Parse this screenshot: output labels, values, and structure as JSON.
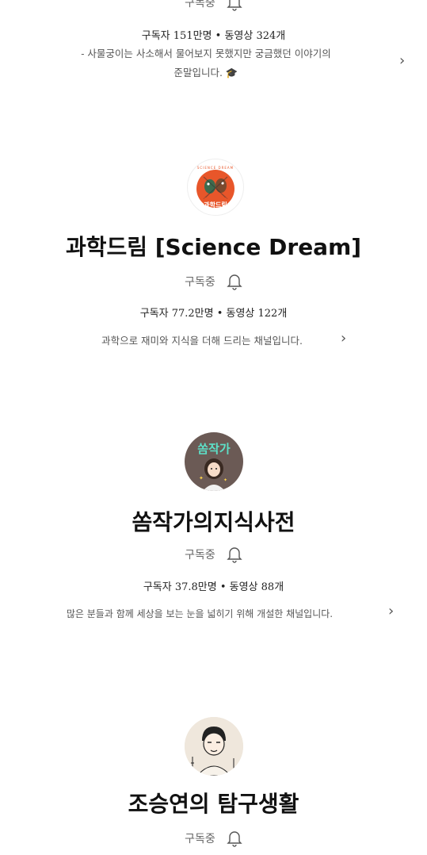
{
  "channels": [
    {
      "subscribed_label": "구독중",
      "stats": "구독자 151만명 • 동영상 324개",
      "description_line1": "- 사물궁이는 사소해서 물어보지 못했지만 궁금했던 이야기의",
      "description_line2": "준말입니다. 🎓"
    },
    {
      "title": "과학드림 [Science Dream]",
      "logo_text": "과학드림",
      "logo_arc_text": "SCIENCE DREAM",
      "subscribed_label": "구독중",
      "stats": "구독자 77.2만명 • 동영상 122개",
      "description": "과학으로 재미와 지식을 더해 드리는 채널입니다."
    },
    {
      "title": "쏨작가의지식사전",
      "logo_text": "쏨작가",
      "subscribed_label": "구독중",
      "stats": "구독자 37.8만명 • 동영상 88개",
      "description": "많은 분들과 함께 세상을 보는 눈을 넓히기 위해 개설한 채널입니다."
    },
    {
      "title": "조승연의 탐구생활",
      "subscribed_label": "구독중"
    }
  ],
  "icons": {
    "bell": "bell-icon",
    "chevron": "chevron-right-icon"
  },
  "colors": {
    "science_dream_bg": "#e8562a",
    "jakga_bg": "#6b5a55",
    "jakga_text": "#5de0c8"
  }
}
